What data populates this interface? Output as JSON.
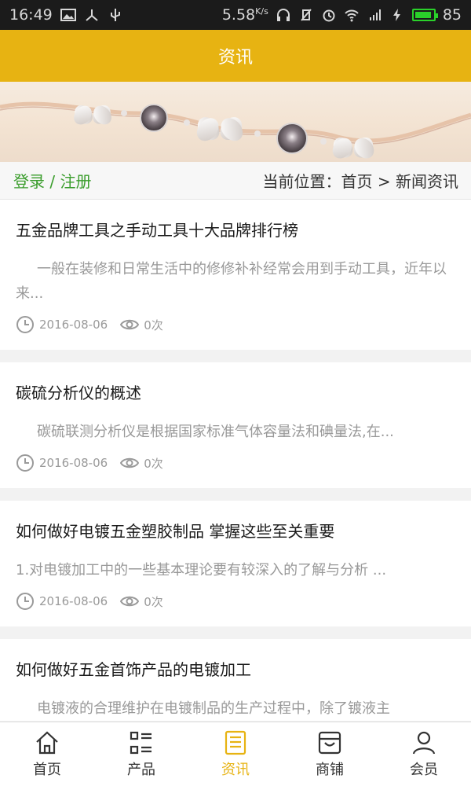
{
  "status_bar": {
    "time": "16:49",
    "speed": "5.58",
    "speed_unit": "K/s",
    "battery": "85",
    "network": "4G"
  },
  "header": {
    "title": "资讯"
  },
  "breadcrumb": {
    "login_register": "登录 / 注册",
    "location": "当前位置：首页 > 新闻资讯"
  },
  "articles": [
    {
      "title": "五金品牌工具之手动工具十大品牌排行榜",
      "summary": "一般在装修和日常生活中的修修补补经常会用到手动工具，近年以来...",
      "date": "2016-08-06",
      "views": "0次"
    },
    {
      "title": "碳硫分析仪的概述",
      "summary": "碳硫联测分析仪是根据国家标准气体容量法和碘量法,在...",
      "date": "2016-08-06",
      "views": "0次"
    },
    {
      "title": "如何做好电镀五金塑胶制品 掌握这些至关重要",
      "summary": "1.对电镀加工中的一些基本理论要有较深入的了解与分析 ...",
      "date": "2016-08-06",
      "views": "0次"
    },
    {
      "title": "如何做好五金首饰产品的电镀加工",
      "summary": "电镀液的合理维护在电镀制品的生产过程中，除了镀液主",
      "date": "",
      "views": ""
    }
  ],
  "tabbar": {
    "items": [
      {
        "label": "首页",
        "icon": "home-icon"
      },
      {
        "label": "产品",
        "icon": "list-icon"
      },
      {
        "label": "资讯",
        "icon": "news-icon",
        "active": true
      },
      {
        "label": "商铺",
        "icon": "store-icon"
      },
      {
        "label": "会员",
        "icon": "user-icon"
      }
    ]
  },
  "colors": {
    "accent": "#e7b312",
    "login_green": "#3a9d2c",
    "status_bar": "#1b1b1b"
  }
}
